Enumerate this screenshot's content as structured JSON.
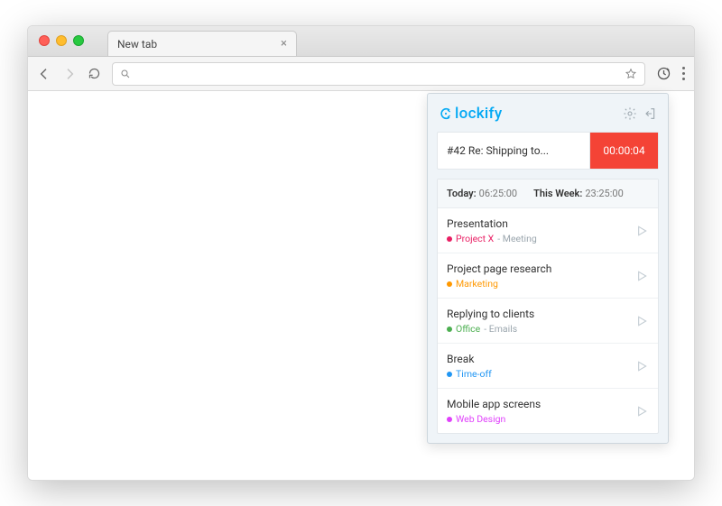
{
  "browser": {
    "tab_title": "New tab",
    "omnibox_value": ""
  },
  "popup": {
    "brand": "lockify",
    "timer": {
      "description": "#42 Re: Shipping to...",
      "elapsed": "00:00:04"
    },
    "summary": {
      "today_label": "Today:",
      "today_value": "06:25:00",
      "week_label": "This Week:",
      "week_value": "23:25:00"
    },
    "entries": [
      {
        "title": "Presentation",
        "project": "Project X",
        "task": "Meeting",
        "color": "#e91e63"
      },
      {
        "title": "Project page research",
        "project": "Marketing",
        "task": "",
        "color": "#ff9800"
      },
      {
        "title": "Replying to clients",
        "project": "Office",
        "task": "Emails",
        "color": "#4caf50"
      },
      {
        "title": "Break",
        "project": "Time-off",
        "task": "",
        "color": "#2196f3"
      },
      {
        "title": "Mobile app screens",
        "project": "Web Design",
        "task": "",
        "color": "#e040fb"
      }
    ]
  }
}
